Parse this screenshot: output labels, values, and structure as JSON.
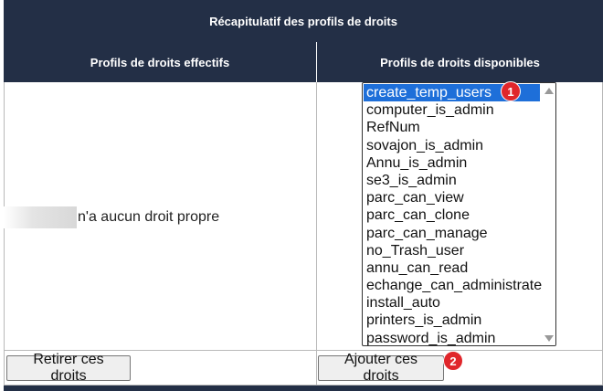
{
  "header": {
    "title": "Récapitulatif des profils de droits",
    "col_effective": "Profils de droits effectifs",
    "col_available": "Profils de droits disponibles"
  },
  "effective": {
    "no_rights_text": "n'a aucun droit propre"
  },
  "available": {
    "items": [
      {
        "label": "create_temp_users",
        "selected": true
      },
      {
        "label": "computer_is_admin",
        "selected": false
      },
      {
        "label": "RefNum",
        "selected": false
      },
      {
        "label": "sovajon_is_admin",
        "selected": false
      },
      {
        "label": "Annu_is_admin",
        "selected": false
      },
      {
        "label": "se3_is_admin",
        "selected": false
      },
      {
        "label": "parc_can_view",
        "selected": false
      },
      {
        "label": "parc_can_clone",
        "selected": false
      },
      {
        "label": "parc_can_manage",
        "selected": false
      },
      {
        "label": "no_Trash_user",
        "selected": false
      },
      {
        "label": "annu_can_read",
        "selected": false
      },
      {
        "label": "echange_can_administrate",
        "selected": false
      },
      {
        "label": "install_auto",
        "selected": false
      },
      {
        "label": "printers_is_admin",
        "selected": false
      },
      {
        "label": "password_is_admin",
        "selected": false
      }
    ]
  },
  "buttons": {
    "remove_label": "Retirer ces droits",
    "add_label": "Ajouter ces droits"
  },
  "badges": {
    "one": "1",
    "two": "2"
  },
  "colors": {
    "header_bg": "#232f46",
    "selection": "#1e6fd9",
    "badge": "#e0262b"
  }
}
